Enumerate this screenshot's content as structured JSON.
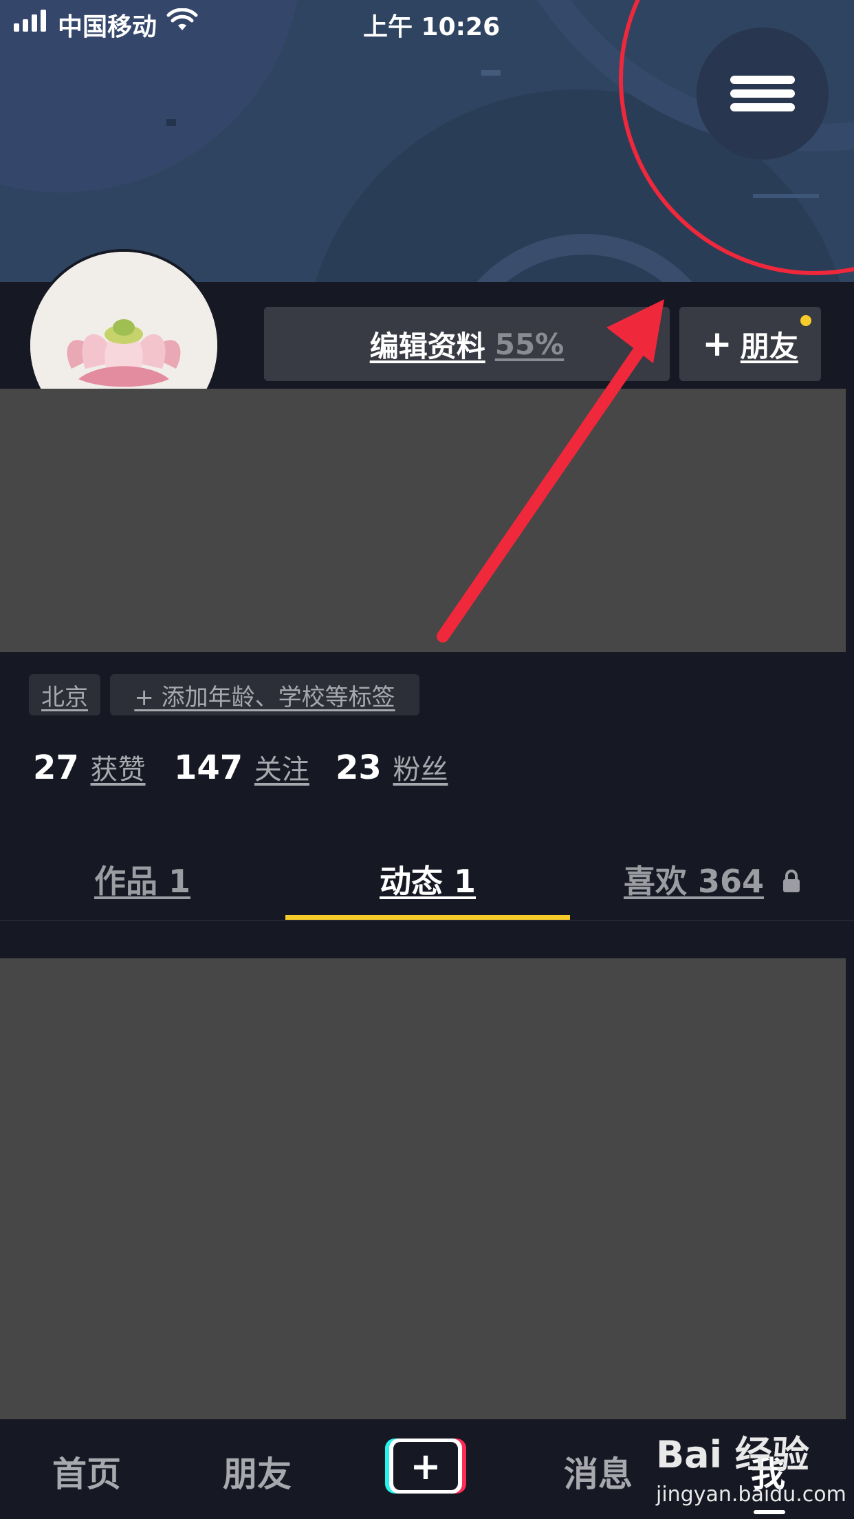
{
  "status_bar": {
    "carrier": "中国移动",
    "time": "上午 10:26"
  },
  "profile": {
    "edit_label": "编辑资料",
    "edit_percent": "55%",
    "add_friend_plus": "+",
    "add_friend_label": "朋友"
  },
  "tags": {
    "location": "北京",
    "add_tag": "+ 添加年龄、学校等标签"
  },
  "stats": [
    {
      "value": "27",
      "label": "获赞"
    },
    {
      "value": "147",
      "label": "关注"
    },
    {
      "value": "23",
      "label": "粉丝"
    }
  ],
  "tabs": [
    {
      "label": "作品 1"
    },
    {
      "label": "动态 1"
    },
    {
      "label": "喜欢 364"
    }
  ],
  "bottom_nav": [
    {
      "label": "首页"
    },
    {
      "label": "朋友"
    },
    {
      "label": "+"
    },
    {
      "label": "消息"
    },
    {
      "label": "我"
    }
  ],
  "watermark": {
    "logo": "Bai 经验",
    "url": "jingyan.baidu.com"
  },
  "colors": {
    "background": "#161823",
    "tab_accent": "#f6cb2a",
    "annotation": "#f0283c",
    "placeholder": "#474747"
  },
  "icons": [
    "signal-icon",
    "wifi-icon",
    "menu-icon",
    "lock-icon",
    "plus-icon"
  ]
}
